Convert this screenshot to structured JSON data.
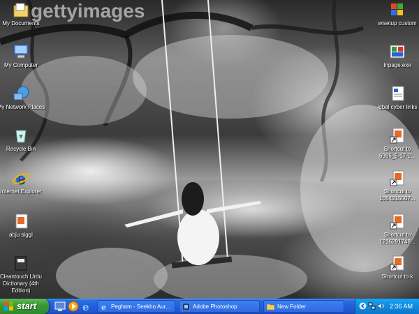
{
  "watermark": "gettyimages",
  "desktop_icons_left": [
    {
      "label": "My Documents",
      "icon": "my-documents-icon"
    },
    {
      "label": "My Computer",
      "icon": "my-computer-icon"
    },
    {
      "label": "My Network Places",
      "icon": "network-places-icon"
    },
    {
      "label": "Recycle Bin",
      "icon": "recycle-bin-icon"
    },
    {
      "label": "Internet Explorer",
      "icon": "internet-explorer-icon"
    },
    {
      "label": "abju siggi",
      "icon": "document-icon"
    },
    {
      "label": "Cleantouch Urdu Dictionary (4th Edition)",
      "icon": "dictionary-icon"
    }
  ],
  "desktop_icons_right": [
    {
      "label": "wisetup custom",
      "icon": "windows-setup-icon"
    },
    {
      "label": "Inpage.exe",
      "icon": "inpage-icon"
    },
    {
      "label": "iqbal cyber links",
      "icon": "document-icon"
    },
    {
      "label": "Shortcut to 6986_5-17-2...",
      "icon": "document-shortcut-icon"
    },
    {
      "label": "Shortcut to 1054215007...",
      "icon": "document-shortcut-icon"
    },
    {
      "label": "Shortcut to 1216291748...",
      "icon": "document-shortcut-icon"
    },
    {
      "label": "Shortcut to k",
      "icon": "document-shortcut-icon"
    }
  ],
  "taskbar": {
    "start_label": "start",
    "quick_launch": [
      "desktop-icon",
      "media-player-icon",
      "internet-explorer-icon"
    ],
    "tasks": [
      {
        "label": "Pegham - Seekho Aur...",
        "icon": "internet-explorer-icon"
      },
      {
        "label": "Adobe Photoshop",
        "icon": "photoshop-icon"
      },
      {
        "label": "New Folder",
        "icon": "folder-icon"
      }
    ],
    "tray": {
      "clock": "2:36 AM",
      "icons": [
        "back-arrow-icon",
        "network-icon",
        "volume-icon"
      ]
    }
  }
}
